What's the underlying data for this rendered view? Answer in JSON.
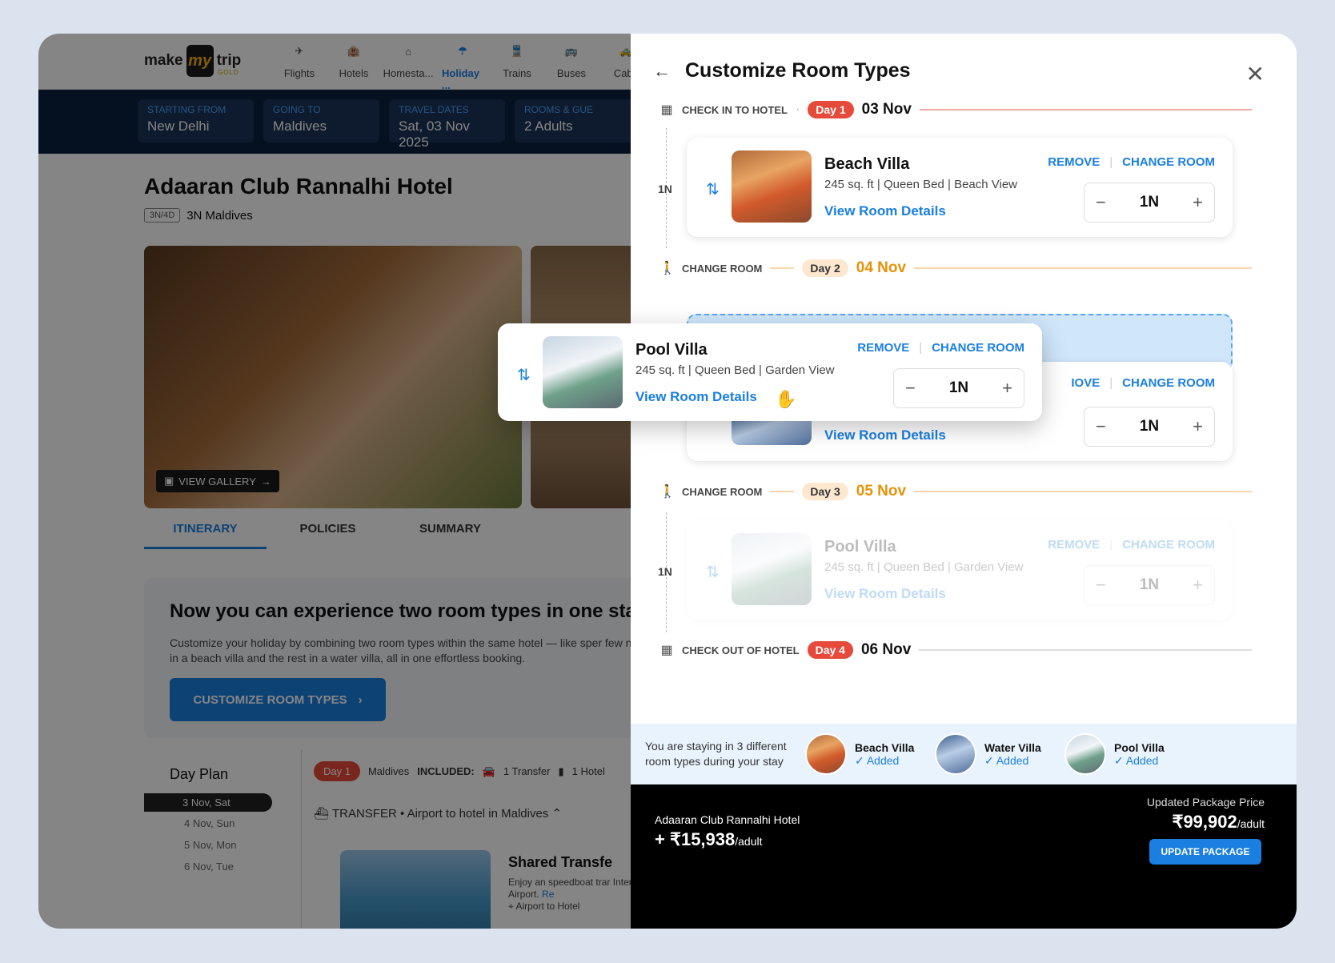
{
  "logo": {
    "left": "make",
    "mid": "my",
    "right": "trip",
    "tier": "GOLD"
  },
  "nav": [
    {
      "label": "Flights",
      "icon": "plane-icon"
    },
    {
      "label": "Hotels",
      "icon": "hotel-icon"
    },
    {
      "label": "Homesta...",
      "icon": "home-icon"
    },
    {
      "label": "Holiday ...",
      "icon": "umbrella-icon"
    },
    {
      "label": "Trains",
      "icon": "train-icon"
    },
    {
      "label": "Buses",
      "icon": "bus-icon"
    },
    {
      "label": "Cabs",
      "icon": "car-icon"
    }
  ],
  "search": [
    {
      "label": "STARTING FROM",
      "value": "New Delhi"
    },
    {
      "label": "GOING TO",
      "value": "Maldives"
    },
    {
      "label": "TRAVEL DATES",
      "value": "Sat, 03 Nov 2025"
    },
    {
      "label": "ROOMS & GUE",
      "value": "2 Adults"
    }
  ],
  "hotel": {
    "name": "Adaaran Club Rannalhi Hotel",
    "badge": "3N/4D",
    "duration": "3N Maldives"
  },
  "gallery": {
    "label": "VIEW GALLERY"
  },
  "tabs": [
    "ITINERARY",
    "POLICIES",
    "SUMMARY"
  ],
  "promo": {
    "title": "Now you can experience two room types in one stay!",
    "desc": "Customize your holiday by combining two room types within the same hotel — like sper few nights in a beach villa and the rest in a water villa, all in one effortless booking.",
    "cta": "CUSTOMIZE ROOM TYPES"
  },
  "dayplan": {
    "title": "Day Plan",
    "days": [
      "3 Nov, Sat",
      "4 Nov, Sun",
      "5 Nov, Mon",
      "6 Nov, Tue"
    ],
    "day_pill": "Day 1",
    "dest": "Maldives",
    "included_label": "INCLUDED:",
    "inc1": "1 Transfer",
    "inc2": "1 Hotel",
    "transfer_label": "TRANSFER",
    "transfer_desc": "Airport to hotel in Maldives",
    "shared": "Shared Transfe",
    "shared_desc": "Enjoy an speedboat trar International Airport.",
    "shared_link": "Re",
    "location": "Airport to Hotel"
  },
  "panel": {
    "title": "Customize Room Types",
    "checkin": {
      "label": "CHECK IN TO HOTEL",
      "pill": "Day 1",
      "date": "03 Nov"
    },
    "change1": {
      "label": "CHANGE ROOM",
      "pill": "Day 2",
      "date": "04 Nov"
    },
    "change2": {
      "label": "CHANGE ROOM",
      "pill": "Day 3",
      "date": "05 Nov"
    },
    "checkout": {
      "label": "CHECK OUT OF HOTEL",
      "pill": "Day 4",
      "date": "06 Nov"
    },
    "nights": "1N",
    "remove": "REMOVE",
    "change_room": "CHANGE ROOM",
    "view_details": "View Room Details",
    "rooms": [
      {
        "name": "Beach Villa",
        "desc": "245 sq. ft | Queen Bed | Beach View",
        "nights": "1N"
      },
      {
        "name": "Pool Villa",
        "desc": "245 sq. ft | Queen Bed | Garden View",
        "nights": "1N"
      },
      {
        "name": "Pool Villa",
        "desc": "245 sq. ft | Queen Bed | Garden View",
        "nights": "1N"
      }
    ],
    "hidden_card": {
      "remove_partial": "IOVE",
      "change_room": "CHANGE ROOM",
      "view": "View Room Details",
      "nights": "1N"
    },
    "summary_text": "You are staying in 3 different room types during your stay",
    "summary_rooms": [
      {
        "name": "Beach Villa",
        "status": "✓ Added"
      },
      {
        "name": "Water Villa",
        "status": "✓ Added"
      },
      {
        "name": "Pool Villa",
        "status": "✓ Added"
      }
    ],
    "footer": {
      "hotel": "Adaaran Club Rannalhi Hotel",
      "price": "+ ₹15,938",
      "unit": "/adult",
      "updated_label": "Updated Package Price",
      "updated_price": "₹99,902",
      "button": "UPDATE PACKAGE"
    }
  },
  "colors": {
    "accent": "#1a7fe0",
    "red": "#e64a3b",
    "orange": "#e6920a",
    "navy": "#0b1f3e"
  }
}
